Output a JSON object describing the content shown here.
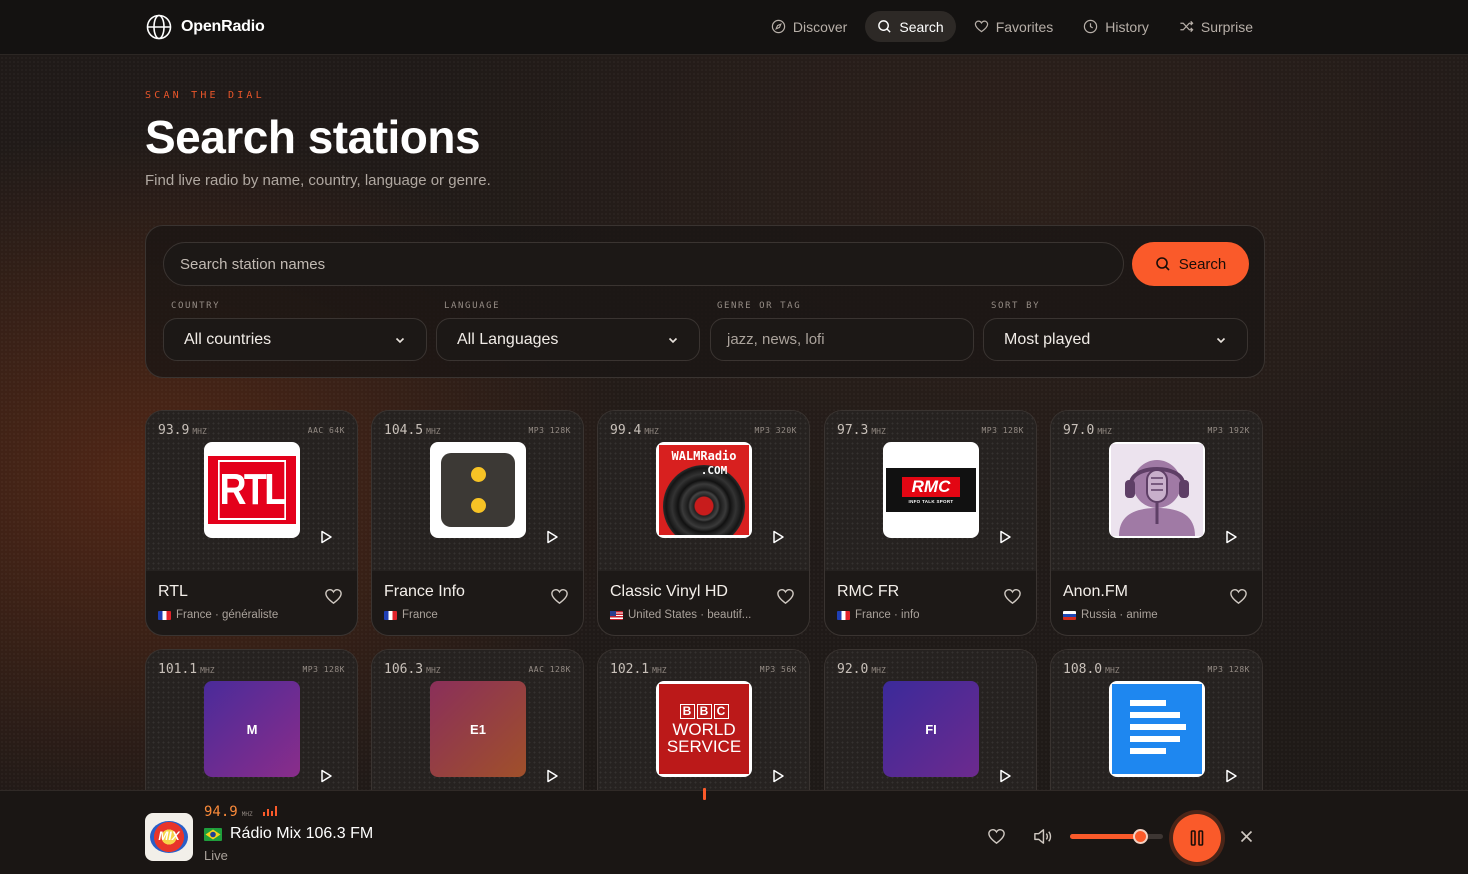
{
  "brand": {
    "name": "OpenRadio",
    "icon": "globe-icon"
  },
  "nav": {
    "items": [
      {
        "label": "Discover",
        "icon": "compass-icon",
        "active": false
      },
      {
        "label": "Search",
        "icon": "search-icon",
        "active": true
      },
      {
        "label": "Favorites",
        "icon": "heart-icon",
        "active": false
      },
      {
        "label": "History",
        "icon": "clock-icon",
        "active": false
      },
      {
        "label": "Surprise",
        "icon": "shuffle-icon",
        "active": false
      }
    ]
  },
  "hero": {
    "eyebrow": "SCAN THE DIAL",
    "title": "Search stations",
    "subtitle": "Find live radio by name, country, language or genre."
  },
  "search": {
    "placeholder": "Search station names",
    "button_label": "Search",
    "filters": {
      "country": {
        "label": "COUNTRY",
        "value": "All countries"
      },
      "language": {
        "label": "LANGUAGE",
        "value": "All Languages"
      },
      "genre": {
        "label": "GENRE OR TAG",
        "placeholder": "jazz, news, lofi"
      },
      "sort": {
        "label": "SORT BY",
        "value": "Most played"
      }
    }
  },
  "stations": [
    {
      "freq": "93.9",
      "unit": "MHZ",
      "codec": "AAC 64K",
      "name": "RTL",
      "meta": "France · généraliste",
      "country": "france",
      "art": "rtl-logo"
    },
    {
      "freq": "104.5",
      "unit": "MHZ",
      "codec": "MP3 128K",
      "name": "France Info",
      "meta": "France",
      "country": "france",
      "art": "franceinfo-logo"
    },
    {
      "freq": "99.4",
      "unit": "MHZ",
      "codec": "MP3 320K",
      "name": "Classic Vinyl HD",
      "meta": "United States · beautif...",
      "country": "usa",
      "art": "walmradio-logo",
      "art_text": [
        "WALMRadio",
        ".COM"
      ]
    },
    {
      "freq": "97.3",
      "unit": "MHZ",
      "codec": "MP3 128K",
      "name": "RMC FR",
      "meta": "France · info",
      "country": "france",
      "art": "rmc-logo",
      "art_text": [
        "RMC",
        "INFO TALK SPORT"
      ]
    },
    {
      "freq": "97.0",
      "unit": "MHZ",
      "codec": "MP3 192K",
      "name": "Anon.FM",
      "meta": "Russia · anime",
      "country": "russia",
      "art": "anon-logo"
    },
    {
      "freq": "101.1",
      "unit": "MHZ",
      "codec": "MP3 128K",
      "initials": "M",
      "art": "initials",
      "gradient": [
        "#4a2b9a",
        "#8a2d8a"
      ]
    },
    {
      "freq": "106.3",
      "unit": "MHZ",
      "codec": "AAC 128K",
      "initials": "E1",
      "art": "initials",
      "gradient": [
        "#8a2f5a",
        "#a0502a"
      ]
    },
    {
      "freq": "102.1",
      "unit": "MHZ",
      "codec": "MP3 56K",
      "art": "bbc-logo",
      "art_text": [
        "B",
        "B",
        "C",
        "WORLD",
        "SERVICE"
      ]
    },
    {
      "freq": "92.0",
      "unit": "MHZ",
      "codec": "",
      "initials": "FI",
      "art": "initials",
      "gradient": [
        "#3b2a9a",
        "#6d2a8e"
      ]
    },
    {
      "freq": "108.0",
      "unit": "MHZ",
      "codec": "MP3 128K",
      "art": "doc-logo"
    }
  ],
  "player": {
    "freq": "94.9",
    "unit": "MHZ",
    "name": "Rádio Mix 106.3 FM",
    "country": "brazil",
    "status": "Live",
    "volume": 0.76,
    "art_text": "MIX",
    "colors": {
      "accent": "#fa5a2a"
    }
  }
}
